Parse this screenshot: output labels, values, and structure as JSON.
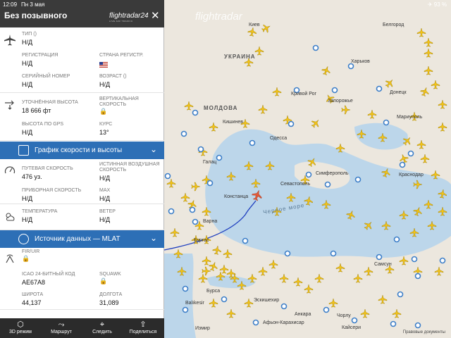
{
  "status": {
    "time": "12:09",
    "date": "Пн 3 мая",
    "right": "✈ 93 %"
  },
  "panel": {
    "title": "Без позывного",
    "logo": "flightradar24",
    "logo_sub": "LIVE AIR TRAFFIC",
    "aircraft": {
      "type_label": "ТИП ()",
      "type_value": "Н/Д",
      "reg_label": "РЕГИСТРАЦИЯ",
      "reg_value": "Н/Д",
      "country_label": "СТРАНА РЕГИСТР.",
      "serial_label": "СЕРИЙНЫЙ НОМЕР",
      "serial_value": "Н/Д",
      "age_label": "ВОЗРАСТ ()",
      "age_value": "Н/Д"
    },
    "altitude": {
      "cal_label": "УТОЧНЁННАЯ ВЫСОТА",
      "cal_value": "18 666 фт",
      "vs_label": "ВЕРТИКАЛЬНАЯ СКОРОСТЬ",
      "gps_label": "ВЫСОТА ПО GPS",
      "gps_value": "Н/Д",
      "track_label": "КУРС",
      "track_value": "13°"
    },
    "speed_bar": "График скорости и высоты",
    "speed": {
      "gs_label": "ПУТЕВАЯ СКОРОСТЬ",
      "gs_value": "476 уз.",
      "tas_label": "ИСТИННАЯ ВОЗДУШНАЯ СКОРОСТЬ",
      "tas_value": "Н/Д",
      "ias_label": "ПРИБОРНАЯ СКОРОСТЬ",
      "ias_value": "Н/Д",
      "max_label": "MAX",
      "max_value": "Н/Д"
    },
    "weather": {
      "temp_label": "ТЕМПЕРАТУРА",
      "temp_value": "Н/Д",
      "wind_label": "ВЕТЕР",
      "wind_value": "Н/Д"
    },
    "source_bar": "Источник данных — MLAT",
    "source": {
      "fir_label": "FIR/UIR",
      "icao_label": "ICAO 24-БИТНЫЙ КОД",
      "icao_value": "AE67A8",
      "squawk_label": "SQUAWK",
      "lat_label": "ШИРОТА",
      "lat_value": "44,137",
      "lon_label": "ДОЛГОТА",
      "lon_value": "31,089"
    },
    "toolbar": {
      "mode3d": "3D режим",
      "route": "Маршрут",
      "follow": "Следить",
      "share": "Поделиться"
    }
  },
  "map": {
    "logo": "flightradar",
    "countries": {
      "ukraine": "УКРАИНА",
      "moldova": "МОЛДОВА"
    },
    "sea": "Черное море",
    "cities": {
      "kiev": "Киев",
      "kharkov": "Харьков",
      "belgorod": "Белгород",
      "krivoy_rog": "Кривой Рог",
      "zaporozhye": "Запорожье",
      "donetsk": "Донецк",
      "odessa": "Одесса",
      "simferopol": "Симферополь",
      "sevastopol": "Севастополь",
      "mariupol": "Мариуполь",
      "krasnodar": "Краснодар",
      "kishinev": "Кишинев",
      "constanta": "Констанца",
      "varna": "Варна",
      "burgas": "Бургас",
      "samsun": "Самсун",
      "ankara": "Анкара",
      "kayseri": "Кайсери",
      "izmir": "Измир",
      "eskisehir": "Эскишехир",
      "balikesir": "Balıkesir",
      "bursa": "Бурса",
      "galati": "Галац",
      "chorlu": "Чорлу",
      "afyon": "Афьон-Карахисар"
    },
    "footer": "Правовые документы"
  }
}
